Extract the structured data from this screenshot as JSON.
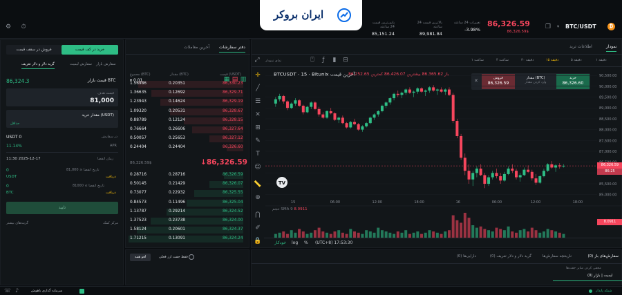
{
  "header": {
    "pair": "BTC/USDT",
    "last_price": "86,326.59",
    "last_price_sub": "86,326.59$",
    "change_label": "تغییرات 24 ساعته",
    "change_value": "-3.98%",
    "high_label": "بالاترین قیمت 24 ساعته",
    "high_value": "89,981.84",
    "low_label": "پایین‌ترین قیمت 24 ساعته",
    "low_value": "85,151.24",
    "logo_text": "ایران بروکر"
  },
  "chart": {
    "tab_chart": "نمودار",
    "tab_info": "اطلاعات ترید",
    "intervals": [
      "۱ ساعت",
      "۴ ساعت",
      "۳۰ دقیقه",
      "۱۵ دقیقه",
      "۵ دقیقه",
      "۱ دقیقه"
    ],
    "title": "BTCUSDT · 15 · Bitunix  آخرین قیمت",
    "ohlc": "باز 86,365.62  بیشترین 86,426.07  کمترین 86,252.65",
    "buy_label": "خرید",
    "buy_price": "86,326.60",
    "sell_label": "فروش",
    "sell_price": "86,326.59",
    "amount_label": "مقدار (BTC)",
    "amount_hint": "وارد کردن مقدار",
    "volume_label": "حجم  SMA 9",
    "volume_value": "8.0911",
    "volume_badge": "8.0911",
    "price_badge_1": "86,326.59",
    "price_badge_2": "86:25",
    "y_ticks": [
      "90,500.00",
      "90,000.00",
      "89,500.00",
      "89,000.00",
      "88,500.00",
      "88,000.00",
      "87,500.00",
      "87,000.00",
      "86,500.00",
      "86,000.00",
      "85,500.00",
      "85,000.00"
    ],
    "x_ticks": [
      "15",
      "06:00",
      "12:00",
      "18:00",
      "16",
      "06:00",
      "12:00",
      "18:00"
    ],
    "timezone": "(UTC+8) 17:53:30",
    "log": "log",
    "pct": "%",
    "auto": "خودکار",
    "toolbar_right": "نمای نمودار",
    "candles": [
      [
        89200,
        89500,
        89050,
        89400
      ],
      [
        89400,
        89650,
        89300,
        89550
      ],
      [
        89550,
        89600,
        89200,
        89300
      ],
      [
        89300,
        89350,
        88900,
        89000
      ],
      [
        89000,
        89250,
        88950,
        89200
      ],
      [
        89200,
        89450,
        89100,
        89350
      ],
      [
        89350,
        89400,
        89050,
        89100
      ],
      [
        89100,
        89150,
        88700,
        88800
      ],
      [
        88800,
        89100,
        88750,
        89050
      ],
      [
        89050,
        89300,
        88950,
        89250
      ],
      [
        89250,
        89300,
        88900,
        88950
      ],
      [
        88950,
        89050,
        88600,
        88700
      ],
      [
        88700,
        88800,
        88500,
        88550
      ],
      [
        88550,
        88900,
        88500,
        88850
      ],
      [
        88850,
        89000,
        88700,
        88750
      ],
      [
        88750,
        88800,
        88400,
        88450
      ],
      [
        88450,
        88600,
        88300,
        88550
      ],
      [
        88550,
        88650,
        88250,
        88300
      ],
      [
        88300,
        88350,
        88050,
        88100
      ],
      [
        88100,
        88400,
        88050,
        88350
      ],
      [
        88350,
        88500,
        88200,
        88250
      ],
      [
        88250,
        88300,
        87950,
        88000
      ],
      [
        88000,
        88200,
        87900,
        88150
      ],
      [
        88150,
        88350,
        88100,
        88300
      ],
      [
        88300,
        88600,
        88250,
        88550
      ],
      [
        88550,
        88750,
        88450,
        88700
      ],
      [
        88700,
        88900,
        88600,
        88850
      ],
      [
        88850,
        89150,
        88800,
        89100
      ],
      [
        89100,
        89300,
        89000,
        89250
      ],
      [
        89250,
        89500,
        89150,
        89450
      ],
      [
        89450,
        89700,
        89350,
        89650
      ],
      [
        89650,
        89800,
        89500,
        89600
      ],
      [
        89600,
        89750,
        89450,
        89700
      ],
      [
        89700,
        89900,
        89600,
        89850
      ],
      [
        89850,
        89950,
        89650,
        89700
      ],
      [
        89700,
        89800,
        89500,
        89750
      ],
      [
        89750,
        89950,
        89650,
        89900
      ],
      [
        89900,
        89950,
        89700,
        89750
      ],
      [
        89750,
        89850,
        89550,
        89800
      ],
      [
        89800,
        90000,
        89700,
        89950
      ],
      [
        89950,
        90050,
        89750,
        89800
      ],
      [
        89800,
        89900,
        89600,
        89850
      ],
      [
        89850,
        89950,
        89700,
        89750
      ],
      [
        89750,
        89900,
        89600,
        89850
      ],
      [
        89850,
        89950,
        89550,
        89600
      ],
      [
        89600,
        89700,
        88300,
        88400
      ],
      [
        88400,
        88500,
        87600,
        87700
      ],
      [
        87700,
        87800,
        86600,
        86700
      ],
      [
        86700,
        86900,
        85900,
        86100
      ],
      [
        86100,
        86400,
        85500,
        85700
      ],
      [
        85700,
        86100,
        85400,
        86000
      ],
      [
        86000,
        86300,
        85800,
        86200
      ],
      [
        86200,
        86400,
        85850,
        85900
      ],
      [
        85900,
        86000,
        85300,
        85500
      ],
      [
        85500,
        85900,
        85400,
        85800
      ],
      [
        85800,
        86100,
        85700,
        86000
      ],
      [
        86000,
        86200,
        85750,
        85850
      ],
      [
        85850,
        86000,
        85500,
        85650
      ],
      [
        85650,
        86050,
        85600,
        85950
      ],
      [
        85950,
        86300,
        85900,
        86200
      ],
      [
        86200,
        86400,
        86000,
        86100
      ],
      [
        86100,
        86200,
        85700,
        85800
      ],
      [
        85800,
        86000,
        85600,
        85900
      ],
      [
        85900,
        86250,
        85850,
        86150
      ],
      [
        86150,
        86350,
        86000,
        86050
      ],
      [
        86050,
        86150,
        85650,
        85750
      ],
      [
        85750,
        85950,
        85450,
        85550
      ],
      [
        85550,
        85900,
        85500,
        85850
      ],
      [
        85850,
        86200,
        85800,
        86100
      ],
      [
        86100,
        86450,
        86050,
        86400
      ],
      [
        86400,
        86550,
        86200,
        86250
      ],
      [
        86250,
        86400,
        86050,
        86350
      ],
      [
        86350,
        86450,
        86200,
        86300
      ],
      [
        86300,
        86400,
        86250,
        86330
      ]
    ],
    "volumes": [
      3,
      4,
      5,
      3,
      6,
      4,
      7,
      5,
      3,
      4,
      6,
      8,
      5,
      4,
      3,
      5,
      6,
      4,
      3,
      7,
      5,
      4,
      3,
      6,
      5,
      4,
      8,
      6,
      5,
      4,
      3,
      5,
      4,
      6,
      3,
      4,
      5,
      3,
      4,
      6,
      5,
      4,
      3,
      5,
      6,
      18,
      14,
      12,
      20,
      16,
      10,
      8,
      9,
      7,
      6,
      5,
      8,
      7,
      6,
      9,
      5,
      4,
      6,
      7,
      5,
      8,
      6,
      4,
      5,
      7,
      6,
      5,
      4,
      3
    ]
  },
  "orderbook": {
    "tab_book": "دفتر سفارشات",
    "tab_trades": "آخرین معاملات",
    "precision": "0.01",
    "col_price": "قیمت (USDT)",
    "col_amount": "مقدار (BTC)",
    "col_total": "مجموع (BTC)",
    "asks": [
      [
        "86,330.23",
        "0.20351",
        "1.56986"
      ],
      [
        "86,329.71",
        "0.12692",
        "1.36635"
      ],
      [
        "86,329.19",
        "0.14624",
        "1.23943"
      ],
      [
        "86,328.67",
        "0.20531",
        "1.09320"
      ],
      [
        "86,328.15",
        "0.12124",
        "0.88789"
      ],
      [
        "86,327.64",
        "0.26606",
        "0.76664"
      ],
      [
        "86,327.12",
        "0.25653",
        "0.50057"
      ],
      [
        "86,326.60",
        "0.24404",
        "0.24404"
      ]
    ],
    "mid_price": "86,326.59",
    "mid_sub": "86,326.59$",
    "bids": [
      [
        "86,326.59",
        "0.28716",
        "0.28716"
      ],
      [
        "86,326.07",
        "0.21429",
        "0.50145"
      ],
      [
        "86,325.55",
        "0.22932",
        "0.73077"
      ],
      [
        "86,325.04",
        "0.11496",
        "0.84573"
      ],
      [
        "86,324.52",
        "0.29214",
        "1.13787"
      ],
      [
        "86,324.00",
        "0.23738",
        "1.37523"
      ],
      [
        "86,324.37",
        "0.20601",
        "1.58124"
      ],
      [
        "86,324.24",
        "0.13091",
        "1.71215"
      ]
    ]
  },
  "trade": {
    "tab_market": "خرید در کف قیمت",
    "tab_sell": "فروش در سقف قیمت",
    "sub_tab1": "گرید دلار و دلار تعریف",
    "sub_tab2": "سفارش لیمیت",
    "sub_tab3": "سفارش بازار",
    "market_price_label": "قیمت بازار BTC",
    "market_price": "86,324.3",
    "price_label": "قیمت هدف",
    "price_value": "81,000",
    "amount_label": "مقدار خرید (USDT)",
    "amount_hint": "حداقل",
    "profit_label": "در سفارش",
    "apr_label": "APR",
    "apr_value": "11.14%",
    "usdt_label": "USDT 0",
    "expire_label": "زمان انقضا",
    "expire_value": "11:30 2025-12-17",
    "cond1_label": "تاریخ انقضا ≤ 81,000",
    "cond1_value": "0",
    "cond1_unit": "USDT",
    "cond1_link": "دریافت",
    "cond2_label": "تاریخ انقضا ≥ 81000",
    "cond2_value": "0",
    "cond2_unit": "BTC",
    "cond2_link": "دریافت",
    "confirm": "تایید",
    "footer_left": "مرکز کمک",
    "footer_right": "گزینه‌های بیشتر"
  },
  "bottom": {
    "tabs": [
      "سفارش‌های باز (0)",
      "تاریخچه سفارش‌ها",
      "گرید دلار و دلار تعریف (0)",
      "دارایی‌ها (0)"
    ],
    "sub_tab": "لیمیت | بازار (0)",
    "filter_hint": "مخفی کردن سایر جفت‌ها",
    "hide_small": "فقط جفت ارز فعلی",
    "cancel_all": "لغو همه"
  },
  "statusbar": {
    "left": "سرمایه گذاری باهوش",
    "right": "شبکه پایدار"
  }
}
